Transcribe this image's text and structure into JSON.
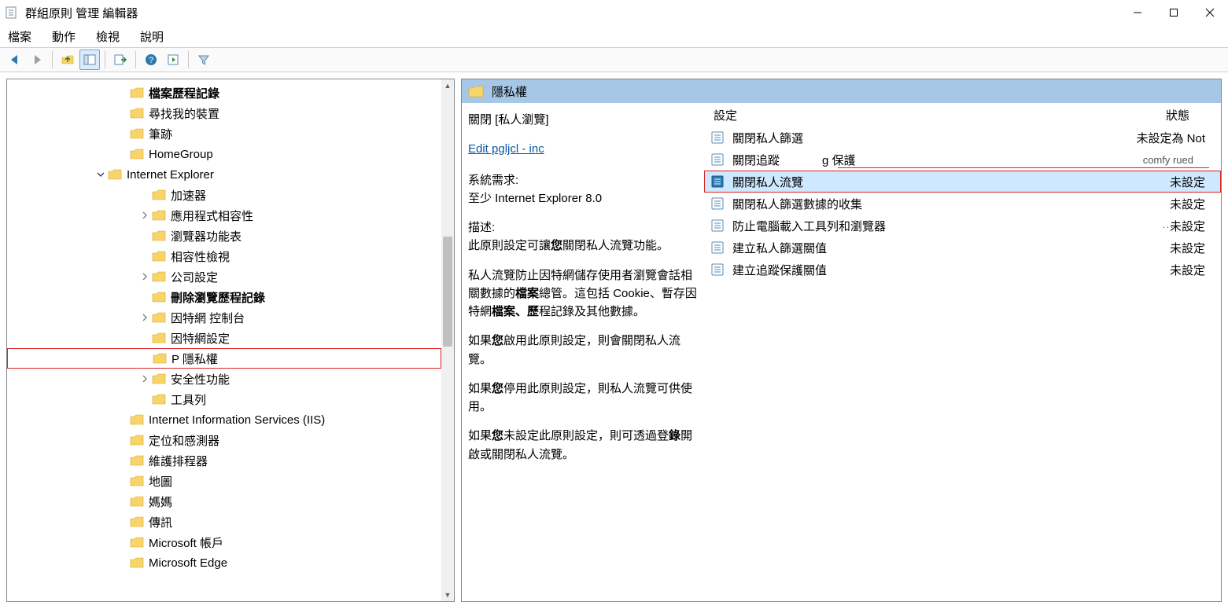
{
  "window": {
    "title": "群組原則 管理 編輯器"
  },
  "menubar": {
    "file": "檔案",
    "action": "動作",
    "view": "檢視",
    "help": "說明"
  },
  "tree": {
    "items": [
      {
        "level": "lvl-0",
        "chev": "",
        "label": "檔案歷程記錄",
        "bold": true
      },
      {
        "level": "lvl-0",
        "chev": "",
        "label": "尋找我的裝置"
      },
      {
        "level": "lvl-0",
        "chev": "",
        "label": "筆跡"
      },
      {
        "level": "lvl-0",
        "chev": "",
        "label": "HomeGroup"
      },
      {
        "level": "lvl-0b",
        "chev": "v",
        "label": "Internet Explorer"
      },
      {
        "level": "lvl-1",
        "chev": "",
        "label": "加速器"
      },
      {
        "level": "lvl-1",
        "chev": ">",
        "label": "應用程式相容性"
      },
      {
        "level": "lvl-1",
        "chev": "",
        "label": "瀏覽器功能表"
      },
      {
        "level": "lvl-1",
        "chev": "",
        "label": "相容性檢視"
      },
      {
        "level": "lvl-1",
        "chev": ">",
        "label": "公司設定"
      },
      {
        "level": "lvl-1",
        "chev": "",
        "label": "刪除瀏覽歷程記錄",
        "bold": true
      },
      {
        "level": "lvl-1",
        "chev": ">",
        "label": "因特網 控制台"
      },
      {
        "level": "lvl-1",
        "chev": "",
        "label": "因特網設定"
      },
      {
        "level": "lvl-1",
        "chev": "",
        "label": "P 隱私權",
        "selected": true
      },
      {
        "level": "lvl-1",
        "chev": ">",
        "label": "安全性功能"
      },
      {
        "level": "lvl-1",
        "chev": "",
        "label": "工具列"
      },
      {
        "level": "lvl-0",
        "chev": "",
        "label": "Internet Information Services (IIS)"
      },
      {
        "level": "lvl-0",
        "chev": "",
        "label": "定位和感測器"
      },
      {
        "level": "lvl-0",
        "chev": "",
        "label": "維護排程器"
      },
      {
        "level": "lvl-0",
        "chev": "",
        "label": "地圖"
      },
      {
        "level": "lvl-0",
        "chev": "",
        "label": "媽媽"
      },
      {
        "level": "lvl-0",
        "chev": "",
        "label": "傳訊"
      },
      {
        "level": "lvl-0",
        "chev": "",
        "label": "Microsoft 帳戶"
      },
      {
        "level": "lvl-0",
        "chev": "",
        "label": "Microsoft Edge"
      }
    ]
  },
  "right": {
    "header_title": "隱私權",
    "column_setting": "設定",
    "column_state": "狀態",
    "desc": {
      "title": "關閉 [私人瀏覽]",
      "edit_link": "Edit pgljcl - inc",
      "req_label": "系統需求:",
      "req_value": "至少 Internet Explorer 8.0",
      "desc_label": "描述:",
      "p1a": "此原則設定可讓",
      "p1b": "您",
      "p1c": "關閉私人流覽功能。",
      "p2a": "私人流覽防止因特網儲存使用者瀏覽會話相關數據的",
      "p2b": "檔案",
      "p2c": "總管。這包括 Cookie、暫存因特網",
      "p2d": "檔案、歷",
      "p2e": "程記錄及其他數據。",
      "p3a": "如果",
      "p3b": "您",
      "p3c": "啟用此原則設定，則會關閉私人流覽。",
      "p4a": "如果",
      "p4b": "您",
      "p4c": "停用此原則設定，則私人流覽可供使用。",
      "p5a": "如果",
      "p5b": "您",
      "p5c": "未設定此原則設定，則可透過登",
      "p5d": "錄",
      "p5e": "開啟或關閉私人流覽。"
    },
    "settings": [
      {
        "name": "關閉私人篩選",
        "state": "未設定為 Not"
      },
      {
        "name": "關閉追蹤",
        "mid": "g 保護",
        "state2": "comfy rued",
        "red_under": true
      },
      {
        "name": "關閉私人流覽",
        "state": "未設定",
        "selected": true
      },
      {
        "name": "關閉私人篩選數據的收集",
        "state": "未設定"
      },
      {
        "name": "防止電腦載入工具列和瀏覽器",
        "state": "未設定",
        "extra": "..."
      },
      {
        "name": "建立私人篩選關值",
        "state": "未設定"
      },
      {
        "name": "建立追蹤保護關值",
        "state": "未設定"
      }
    ]
  }
}
